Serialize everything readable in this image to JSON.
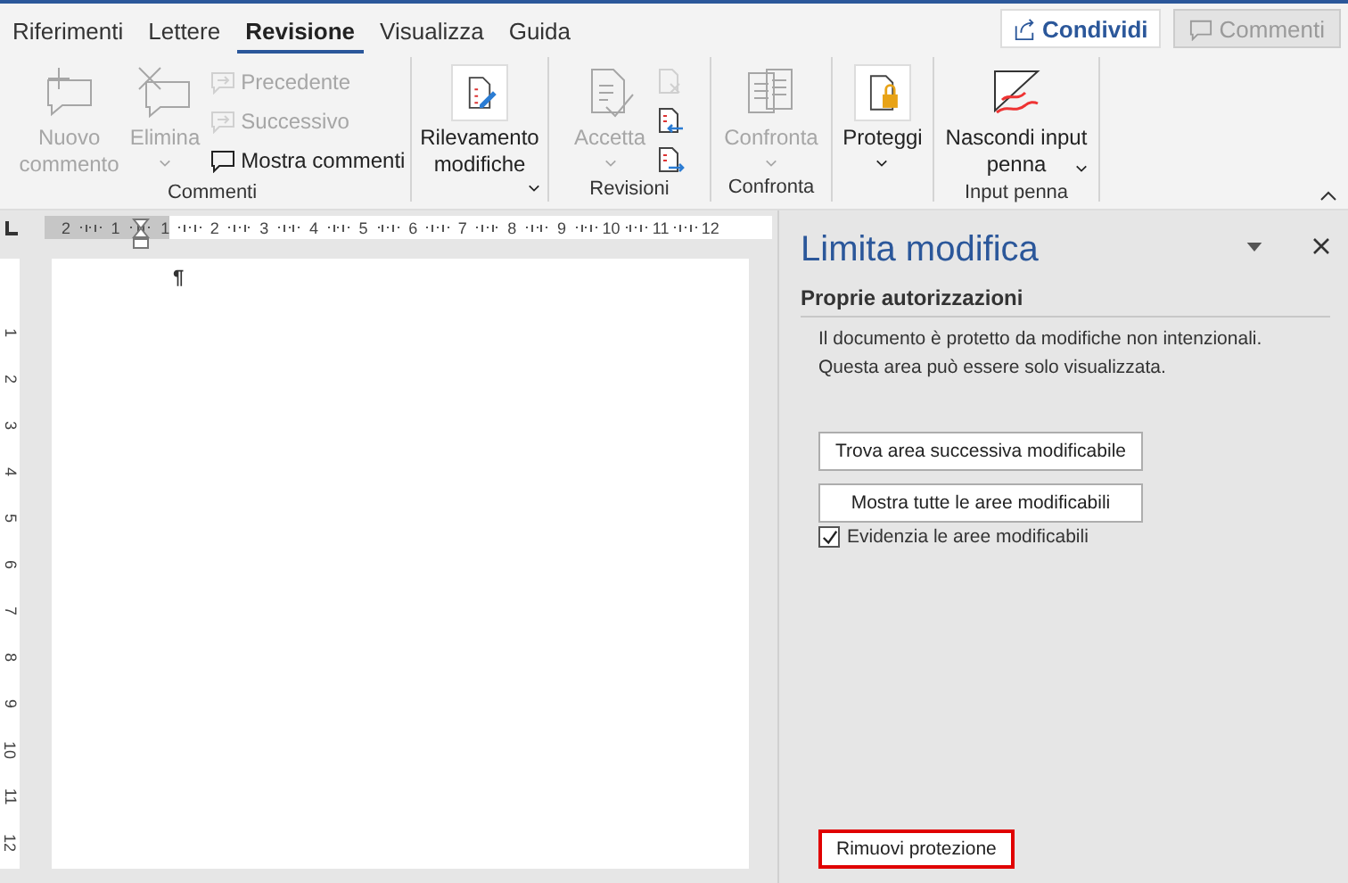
{
  "tabs": [
    {
      "label": "Riferimenti",
      "selected": false
    },
    {
      "label": "Lettere",
      "selected": false
    },
    {
      "label": "Revisione",
      "selected": true
    },
    {
      "label": "Visualizza",
      "selected": false
    },
    {
      "label": "Guida",
      "selected": false
    }
  ],
  "share_button": {
    "label": "Condividi"
  },
  "comments_button": {
    "label": "Commenti",
    "disabled": true
  },
  "ribbon": {
    "groups": [
      {
        "label": "Commenti",
        "items": [
          {
            "kind": "large",
            "label": "Nuovo commento",
            "disabled": true,
            "dropdown": false
          },
          {
            "kind": "large",
            "label": "Elimina",
            "disabled": true,
            "dropdown": true
          },
          {
            "kind": "stack",
            "items": [
              {
                "label": "Precedente",
                "disabled": true
              },
              {
                "label": "Successivo",
                "disabled": true
              },
              {
                "label": "Mostra commenti",
                "disabled": false
              }
            ]
          }
        ]
      },
      {
        "items": [
          {
            "kind": "large",
            "label": "Rilevamento modifiche",
            "disabled": false,
            "dropdown": true
          }
        ]
      },
      {
        "label": "Revisioni",
        "items": [
          {
            "kind": "large",
            "label": "Accetta",
            "disabled": true,
            "dropdown": true
          },
          {
            "kind": "stack",
            "items": [
              {
                "disabled": true
              },
              {
                "disabled": false
              },
              {
                "disabled": false
              }
            ]
          }
        ]
      },
      {
        "label": "Confronta",
        "items": [
          {
            "kind": "large",
            "label": "Confronta",
            "disabled": true,
            "dropdown": true
          }
        ]
      },
      {
        "items": [
          {
            "kind": "large",
            "label": "Proteggi",
            "disabled": false,
            "dropdown": true
          }
        ]
      },
      {
        "label": "Input penna",
        "items": [
          {
            "kind": "large",
            "label": "Nascondi input penna",
            "disabled": false,
            "dropdown": true
          }
        ]
      }
    ]
  },
  "ruler": {
    "horizontal": [
      "2",
      "1",
      "1",
      "2",
      "3",
      "4",
      "5",
      "6",
      "7",
      "8",
      "9",
      "10",
      "11",
      "12"
    ],
    "vertical": [
      "1",
      "2",
      "3",
      "4",
      "5",
      "6",
      "7",
      "8",
      "9",
      "10",
      "11",
      "12"
    ]
  },
  "document": {
    "paragraph_mark": "¶"
  },
  "pane": {
    "title": "Limita modifica",
    "section": "Proprie autorizzazioni",
    "lines": [
      "Il documento è protetto da modifiche non intenzionali.",
      "Questa area può essere solo visualizzata."
    ],
    "buttons": [
      "Trova area successiva modificabile",
      "Mostra tutte le aree modificabili"
    ],
    "checkbox": {
      "label": "Evidenzia le aree modificabili",
      "checked": true
    },
    "remove_button": {
      "label": "Rimuovi protezione",
      "highlighted": true
    }
  }
}
